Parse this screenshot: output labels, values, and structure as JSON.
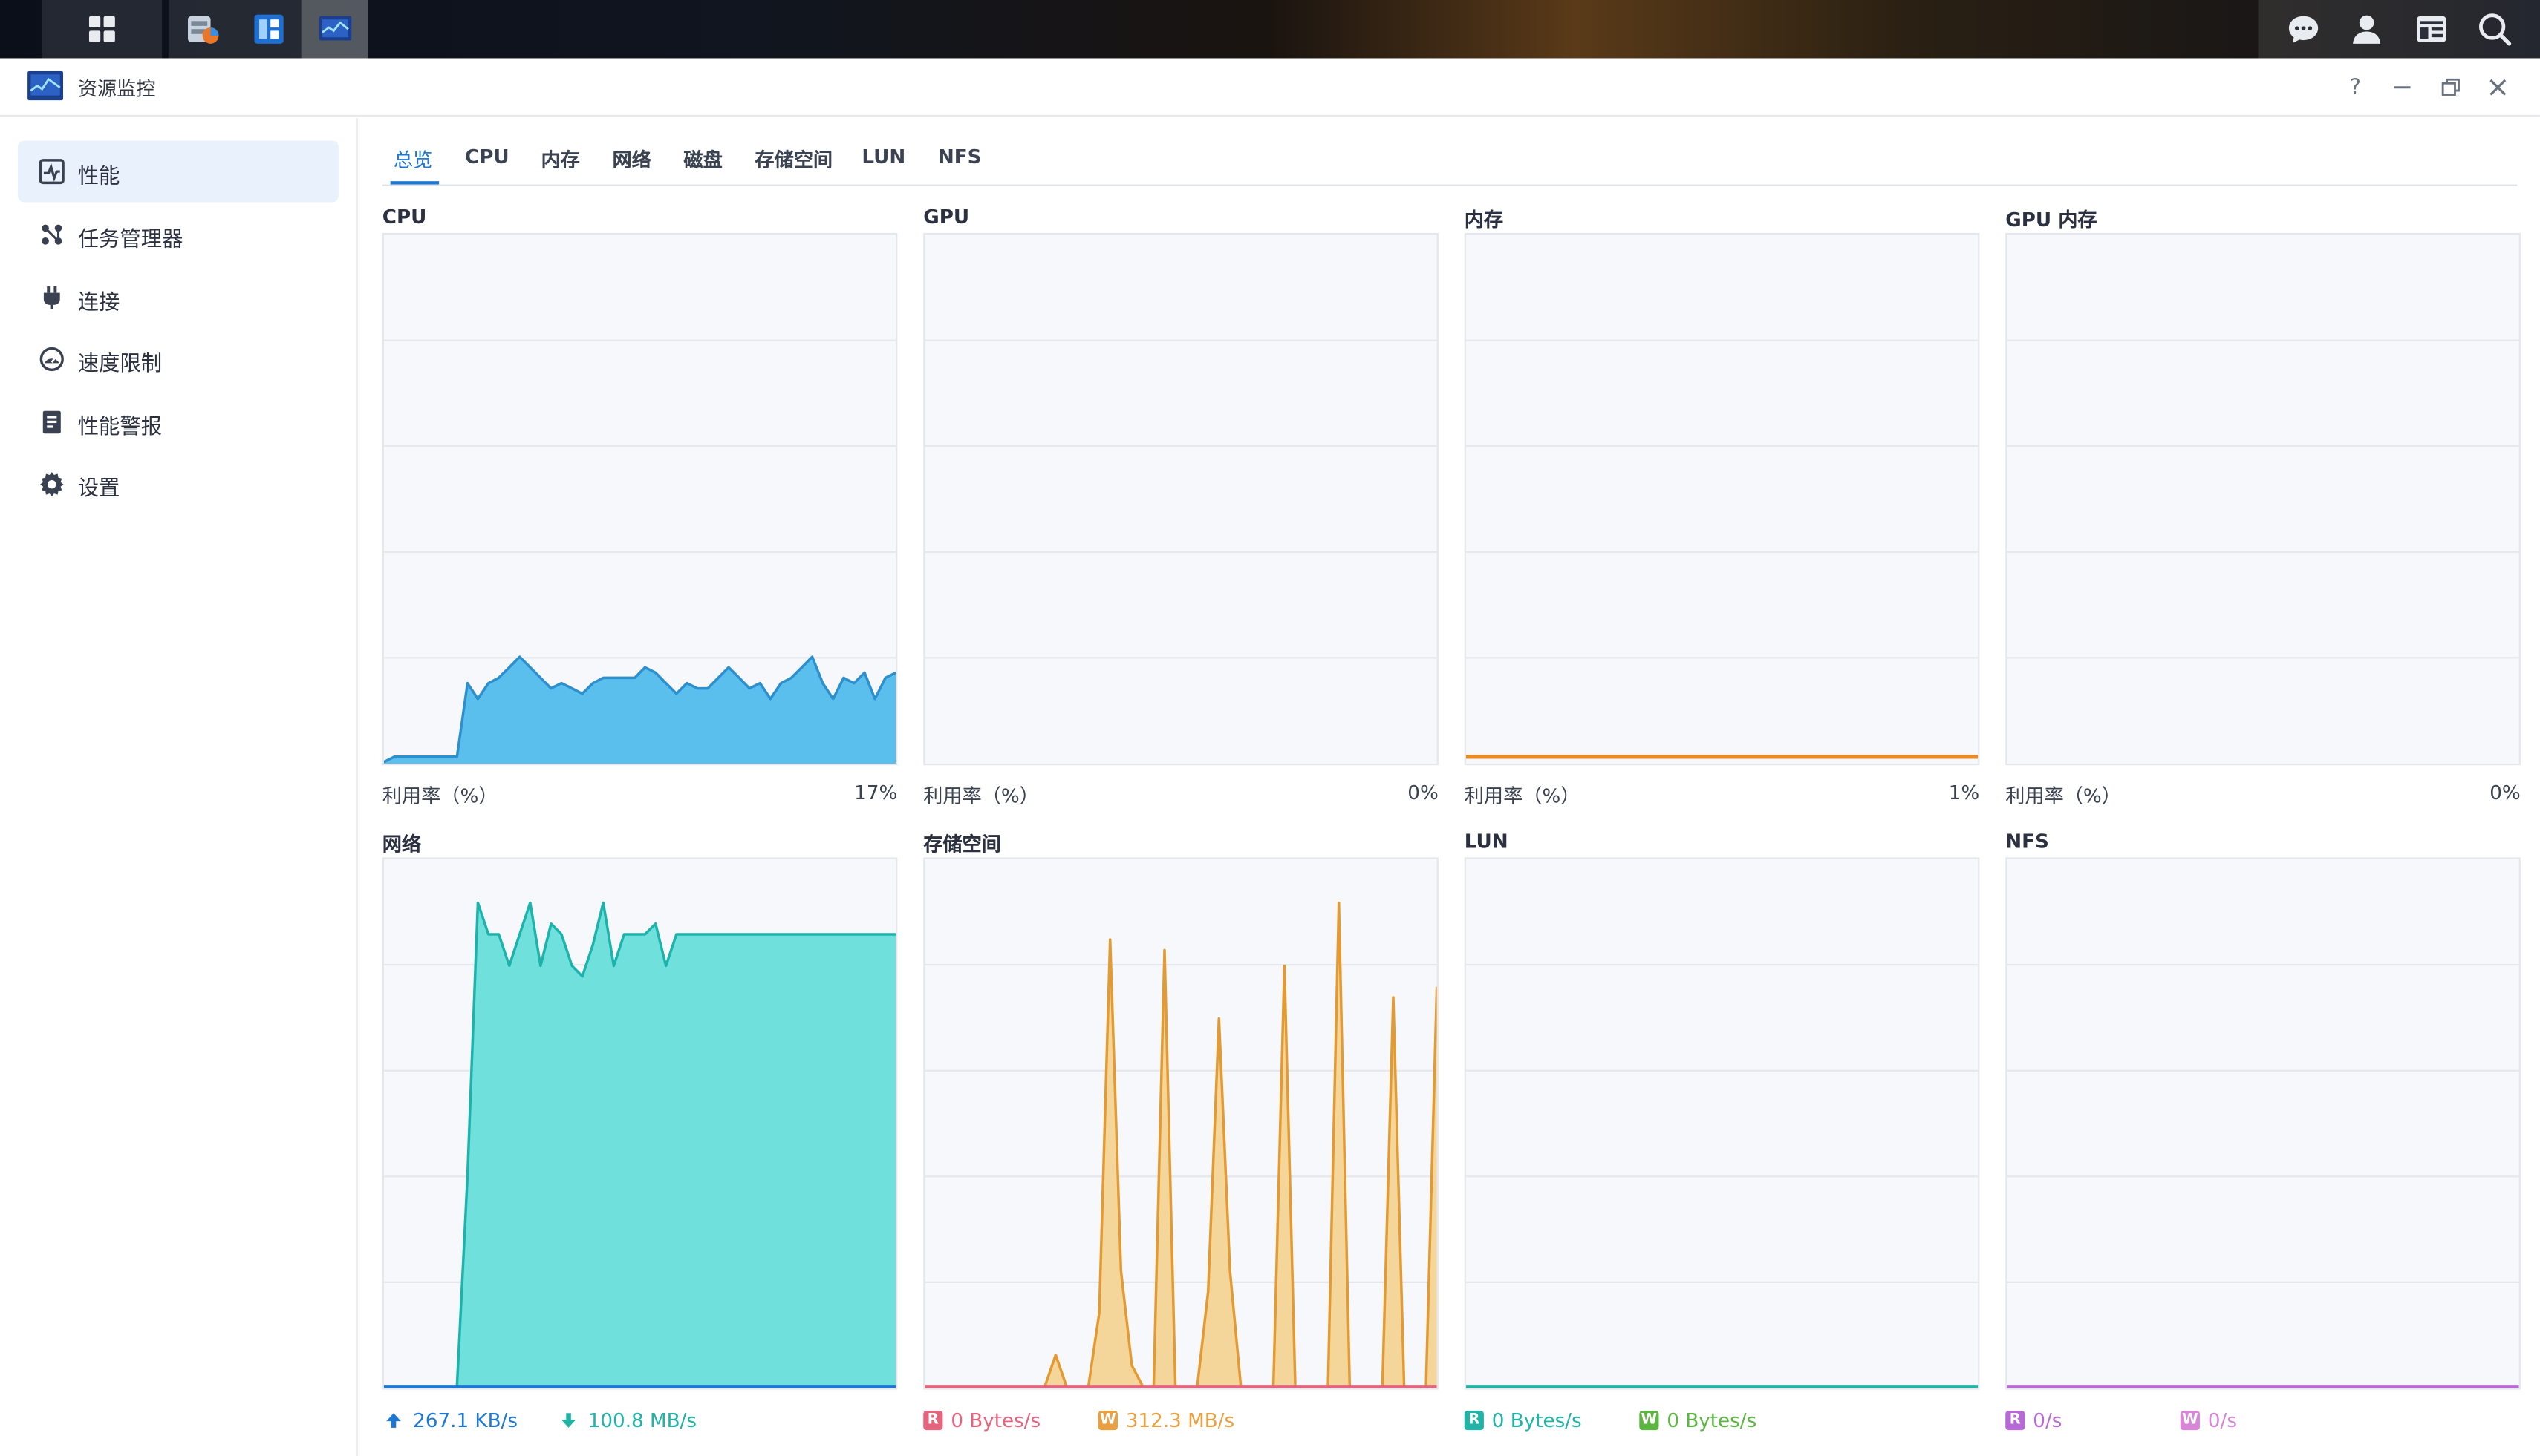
{
  "window": {
    "title": "资源监控"
  },
  "sidebar": {
    "items": [
      {
        "label": "性能",
        "icon": "performance-icon"
      },
      {
        "label": "任务管理器",
        "icon": "task-manager-icon"
      },
      {
        "label": "连接",
        "icon": "plug-icon"
      },
      {
        "label": "速度限制",
        "icon": "speedometer-icon"
      },
      {
        "label": "性能警报",
        "icon": "alert-doc-icon"
      },
      {
        "label": "设置",
        "icon": "gear-icon"
      }
    ]
  },
  "tabs": [
    "总览",
    "CPU",
    "内存",
    "网络",
    "磁盘",
    "存储空间",
    "LUN",
    "NFS"
  ],
  "panels": {
    "cpu": {
      "title": "CPU",
      "label": "利用率（%）",
      "value": "17%"
    },
    "gpu": {
      "title": "GPU",
      "label": "利用率（%）",
      "value": "0%"
    },
    "memory": {
      "title": "内存",
      "label": "利用率（%）",
      "value": "1%"
    },
    "gpu_memory": {
      "title": "GPU 内存",
      "label": "利用率（%）",
      "value": "0%"
    },
    "network": {
      "title": "网络",
      "upload": "267.1 KB/s",
      "download": "100.8 MB/s"
    },
    "volume": {
      "title": "存储空间",
      "read_badge": "R",
      "read": "0 Bytes/s",
      "write_badge": "W",
      "write": "312.3 MB/s"
    },
    "lun": {
      "title": "LUN",
      "read_badge": "R",
      "read": "0 Bytes/s",
      "write_badge": "W",
      "write": "0 Bytes/s"
    },
    "nfs": {
      "title": "NFS",
      "read_badge": "R",
      "read": "0/s",
      "write_badge": "W",
      "write": "0/s"
    }
  },
  "colors": {
    "accent": "#1d78d5",
    "cpu": "#5bbfee",
    "network": "#6fe0dc",
    "volume": "#f5d69a",
    "memory": "#e88a2a",
    "lun_read": "#20b3a6",
    "lun_write": "#5bb540",
    "nfs": "#b76ad6",
    "volume_read": "#e5647d",
    "volume_write": "#e8a040"
  },
  "chart_data": [
    {
      "type": "area",
      "title": "CPU",
      "ylim": [
        0,
        100
      ],
      "series": [
        {
          "name": "CPU",
          "values": [
            0,
            1,
            1,
            1,
            1,
            1,
            1,
            1,
            15,
            12,
            15,
            16,
            18,
            20,
            18,
            16,
            14,
            15,
            14,
            13,
            15,
            16,
            16,
            16,
            16,
            18,
            17,
            15,
            13,
            15,
            14,
            14,
            16,
            18,
            16,
            14,
            15,
            12,
            15,
            16,
            18,
            20,
            15,
            12,
            16,
            15,
            17,
            12,
            16,
            17
          ]
        }
      ]
    },
    {
      "type": "area",
      "title": "GPU",
      "ylim": [
        0,
        100
      ],
      "series": [
        {
          "name": "GPU",
          "values": [
            0,
            0,
            0,
            0,
            0,
            0,
            0,
            0,
            0,
            0
          ]
        }
      ]
    },
    {
      "type": "area",
      "title": "内存",
      "ylim": [
        0,
        100
      ],
      "series": [
        {
          "name": "内存",
          "values": [
            1,
            1,
            1,
            1,
            1,
            1,
            1,
            1,
            1,
            1
          ]
        }
      ]
    },
    {
      "type": "area",
      "title": "GPU 内存",
      "ylim": [
        0,
        100
      ],
      "series": [
        {
          "name": "GPU 内存",
          "values": [
            0,
            0,
            0,
            0,
            0,
            0,
            0,
            0,
            0,
            0
          ]
        }
      ]
    },
    {
      "type": "area",
      "title": "网络",
      "ylim": [
        0,
        100
      ],
      "series": [
        {
          "name": "100.8 MB/s",
          "values": [
            0,
            0,
            0,
            0,
            0,
            0,
            0,
            0,
            40,
            92,
            86,
            86,
            80,
            86,
            92,
            80,
            88,
            86,
            80,
            78,
            84,
            92,
            80,
            86,
            86,
            86,
            88,
            80,
            86,
            86,
            86,
            86,
            86,
            86,
            86,
            86,
            86,
            86,
            86,
            86,
            86,
            86,
            86,
            86,
            86,
            86,
            86,
            86,
            86,
            86
          ]
        }
      ]
    },
    {
      "type": "area",
      "title": "存储空间",
      "ylim": [
        0,
        100
      ],
      "series": [
        {
          "name": "312.3 MB/s",
          "values": [
            0,
            0,
            0,
            0,
            0,
            0,
            0,
            0,
            0,
            0,
            0,
            0,
            6,
            0,
            0,
            0,
            14,
            85,
            22,
            4,
            0,
            0,
            83,
            0,
            0,
            0,
            18,
            70,
            22,
            0,
            0,
            0,
            0,
            80,
            0,
            0,
            0,
            0,
            92,
            0,
            0,
            0,
            0,
            74,
            0,
            0,
            0,
            76
          ]
        }
      ]
    },
    {
      "type": "area",
      "title": "LUN",
      "ylim": [
        0,
        100
      ],
      "series": [
        {
          "name": "LUN",
          "values": [
            0,
            0,
            0,
            0,
            0,
            0,
            0,
            0,
            0,
            0
          ]
        }
      ]
    },
    {
      "type": "area",
      "title": "NFS",
      "ylim": [
        0,
        100
      ],
      "series": [
        {
          "name": "NFS",
          "values": [
            0,
            0,
            0,
            0,
            0,
            0,
            0,
            0,
            0,
            0
          ]
        }
      ]
    }
  ]
}
